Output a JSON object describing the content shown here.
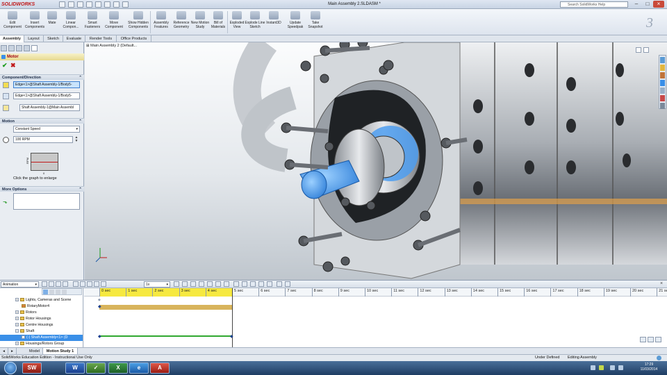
{
  "titlebar": {
    "app_logo": "SOLIDWORKS",
    "document_title": "Main Assembly 2.SLDASM *",
    "help_search_placeholder": "Search SolidWorks Help"
  },
  "ribbon": {
    "buttons": [
      {
        "label": "Edit Component",
        "icon": "edit-component-icon"
      },
      {
        "label": "Insert Components",
        "icon": "insert-components-icon"
      },
      {
        "label": "Mate",
        "icon": "mate-icon"
      },
      {
        "label": "Linear Compon...",
        "icon": "linear-pattern-icon"
      },
      {
        "label": "Smart Fasteners",
        "icon": "smart-fasteners-icon"
      },
      {
        "label": "Move Component",
        "icon": "move-component-icon"
      },
      {
        "label": "Show Hidden Components",
        "icon": "show-hidden-icon"
      },
      {
        "label": "Assembly Features",
        "icon": "assembly-features-icon"
      },
      {
        "label": "Reference Geometry",
        "icon": "reference-geometry-icon"
      },
      {
        "label": "New Motion Study",
        "icon": "motion-study-icon"
      },
      {
        "label": "Bill of Materials",
        "icon": "bom-icon"
      },
      {
        "label": "Exploded View",
        "icon": "exploded-view-icon"
      },
      {
        "label": "Explode Line Sketch",
        "icon": "explode-line-icon"
      },
      {
        "label": "Instant3D",
        "icon": "instant3d-icon"
      },
      {
        "label": "Update Speedpak",
        "icon": "speedpak-icon"
      },
      {
        "label": "Take Snapshot",
        "icon": "snapshot-icon"
      }
    ]
  },
  "tabs": [
    "Assembly",
    "Layout",
    "Sketch",
    "Evaluate",
    "Render Tools",
    "Office Products"
  ],
  "property_manager": {
    "title": "Motor",
    "ok": "✔",
    "cancel": "✖",
    "component_direction": {
      "header": "Component/Direction",
      "motor_location": "Edge<1>@Shaft Assembly-1/Body5-",
      "motor_direction": "Edge<1>@Shaft Assembly-1/Body5-",
      "component_to_move": "Shaft Assembly-1@Main Assembl"
    },
    "motion": {
      "header": "Motion",
      "type": "Constant Speed",
      "speed": "100 RPM",
      "graph_ylabel": "RPM",
      "graph_xlabel": "0",
      "graph_hint": "Click the graph to enlarge"
    },
    "more_options": {
      "header": "More Options"
    }
  },
  "viewport": {
    "tree_root": "Main Assembly 2 (Default..."
  },
  "motion_study": {
    "study_type": "Animation",
    "zoom_value": "1x",
    "tree": [
      {
        "label": "Lights, Cameras and Scene",
        "indent": 1
      },
      {
        "label": "RotaryMotor4",
        "indent": 1
      },
      {
        "label": "Rotors",
        "indent": 1
      },
      {
        "label": "Rotor Housings",
        "indent": 1
      },
      {
        "label": "Centre Housings",
        "indent": 1
      },
      {
        "label": "Shaft",
        "indent": 1
      },
      {
        "label": "(-) Shaft Assembly<1> (D",
        "indent": 2,
        "selected": true
      },
      {
        "label": "Housings/Rotors Group",
        "indent": 1
      }
    ],
    "ticks": [
      "0 sec",
      "1 sec",
      "2 sec",
      "3 sec",
      "4 sec",
      "5 sec",
      "6 sec",
      "7 sec",
      "8 sec",
      "9 sec",
      "10 sec",
      "11 sec",
      "12 sec",
      "13 sec",
      "14 sec",
      "15 sec",
      "16 sec",
      "17 sec",
      "18 sec",
      "19 sec",
      "20 sec",
      "21 sec"
    ],
    "tabs": [
      "Model",
      "Motion Study 1"
    ]
  },
  "status": {
    "left": "SolidWorks Education Edition - Instructional Use Only",
    "under_defined": "Under Defined",
    "editing": "Editing Assembly"
  },
  "taskbar": {
    "apps": [
      "SW",
      "W",
      "✓",
      "X",
      "e",
      "A"
    ],
    "time": "17:29",
    "date": "11/03/2014"
  },
  "colors": {
    "accent_blue": "#3a8fe8",
    "timeline_highlight": "#f6e940",
    "motor_bar": "#d8b45c",
    "shaft_bar": "#2fa82f"
  }
}
